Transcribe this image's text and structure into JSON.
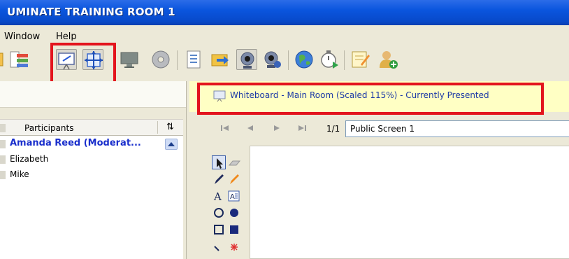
{
  "window": {
    "title": "UMINATE TRAINING ROOM 1"
  },
  "menu": {
    "items": [
      "Window",
      "Help"
    ]
  },
  "participants": {
    "header": "Participants",
    "sort_glyph": "⇅",
    "rows": [
      "Amanda Reed (Moderat...",
      "Elizabeth",
      "Mike"
    ]
  },
  "whiteboard": {
    "status": "Whiteboard - Main Room (Scaled 115%) - Currently Presented",
    "page": "1/1",
    "screen": "Public Screen 1"
  },
  "colors": {
    "title_bar": "#0a55de",
    "highlight": "#e3141d",
    "status_bg": "#ffffc4",
    "moderator_text": "#1a2fcc"
  }
}
